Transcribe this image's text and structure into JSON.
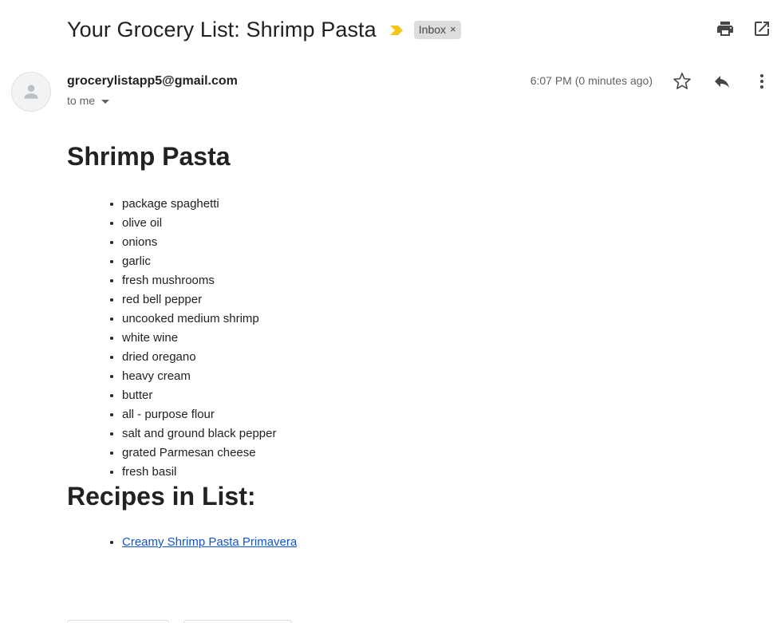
{
  "email": {
    "subject": "Your Grocery List: Shrimp Pasta",
    "label_chip": "Inbox",
    "label_chip_close": "×",
    "sender": "grocerylistapp5@gmail.com",
    "recipient": "to me",
    "timestamp": "6:07 PM (0 minutes ago)",
    "importance_color": "#f5c518"
  },
  "body": {
    "heading": "Shrimp Pasta",
    "ingredients": [
      "package spaghetti",
      "olive oil",
      "onions",
      "garlic",
      "fresh mushrooms",
      "red bell pepper",
      "uncooked medium shrimp",
      "white wine",
      "dried oregano",
      "heavy cream",
      "butter",
      "all - purpose flour",
      "salt and ground black pepper",
      "grated Parmesan cheese",
      "fresh basil"
    ],
    "recipes_heading": "Recipes in List:",
    "recipes": [
      "Creamy Shrimp Pasta Primavera"
    ]
  },
  "icons": {
    "print": "print-icon",
    "open_new_window": "open-in-new-window-icon",
    "star": "star-icon",
    "reply": "reply-icon",
    "more": "more-vert-icon",
    "avatar": "person-avatar-icon",
    "importance": "importance-marker-icon"
  },
  "colors": {
    "link": "#1155cc",
    "chip_bg": "#dddddd",
    "text": "#202124",
    "muted": "#5f6368"
  }
}
